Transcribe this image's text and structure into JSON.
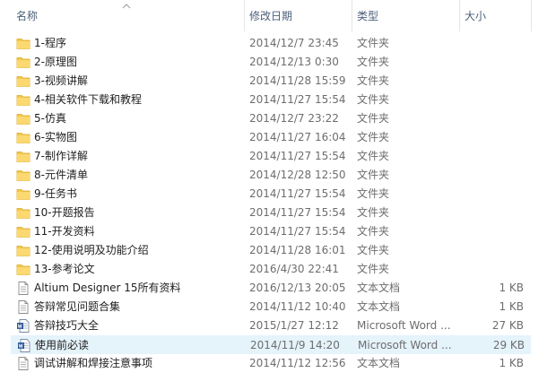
{
  "columns": {
    "name": "名称",
    "date": "修改日期",
    "type": "类型",
    "size": "大小"
  },
  "files": [
    {
      "name": "1-程序",
      "date": "2014/12/7 23:45",
      "type": "文件夹",
      "size": "",
      "icon": "folder-icon"
    },
    {
      "name": "2-原理图",
      "date": "2014/12/13 0:30",
      "type": "文件夹",
      "size": "",
      "icon": "folder-icon"
    },
    {
      "name": "3-视频讲解",
      "date": "2014/11/28 15:59",
      "type": "文件夹",
      "size": "",
      "icon": "folder-icon"
    },
    {
      "name": "4-相关软件下载和教程",
      "date": "2014/11/27 15:54",
      "type": "文件夹",
      "size": "",
      "icon": "folder-icon"
    },
    {
      "name": "5-仿真",
      "date": "2014/12/7 23:22",
      "type": "文件夹",
      "size": "",
      "icon": "folder-icon"
    },
    {
      "name": "6-实物图",
      "date": "2014/11/27 16:04",
      "type": "文件夹",
      "size": "",
      "icon": "folder-icon"
    },
    {
      "name": "7-制作详解",
      "date": "2014/11/27 15:54",
      "type": "文件夹",
      "size": "",
      "icon": "folder-icon"
    },
    {
      "name": "8-元件清单",
      "date": "2014/12/28 12:50",
      "type": "文件夹",
      "size": "",
      "icon": "folder-icon"
    },
    {
      "name": "9-任务书",
      "date": "2014/11/27 15:54",
      "type": "文件夹",
      "size": "",
      "icon": "folder-icon"
    },
    {
      "name": "10-开题报告",
      "date": "2014/11/27 15:54",
      "type": "文件夹",
      "size": "",
      "icon": "folder-icon"
    },
    {
      "name": "11-开发资料",
      "date": "2014/11/27 15:54",
      "type": "文件夹",
      "size": "",
      "icon": "folder-icon"
    },
    {
      "name": "12-使用说明及功能介绍",
      "date": "2014/11/28 16:01",
      "type": "文件夹",
      "size": "",
      "icon": "folder-icon"
    },
    {
      "name": "13-参考论文",
      "date": "2016/4/30 22:41",
      "type": "文件夹",
      "size": "",
      "icon": "folder-icon"
    },
    {
      "name": "Altium Designer 15所有资料",
      "date": "2016/12/13 20:05",
      "type": "文本文档",
      "size": "1 KB",
      "icon": "text-file-icon"
    },
    {
      "name": "答辩常见问题合集",
      "date": "2014/11/12 10:40",
      "type": "文本文档",
      "size": "1 KB",
      "icon": "text-file-icon"
    },
    {
      "name": "答辩技巧大全",
      "date": "2015/1/27 12:12",
      "type": "Microsoft Word ...",
      "size": "27 KB",
      "icon": "word-file-icon"
    },
    {
      "name": "使用前必读",
      "date": "2014/11/9 14:20",
      "type": "Microsoft Word ...",
      "size": "29 KB",
      "icon": "word-file-icon",
      "selected": true
    },
    {
      "name": "调试讲解和焊接注意事项",
      "date": "2014/11/12 12:56",
      "type": "文本文档",
      "size": "1 KB",
      "icon": "text-file-icon"
    }
  ],
  "colors": {
    "header_text": "#4c607a",
    "selected_row": "#e5f3fb",
    "folder": "#f4c84b",
    "secondary_text": "#6d6d6d"
  }
}
